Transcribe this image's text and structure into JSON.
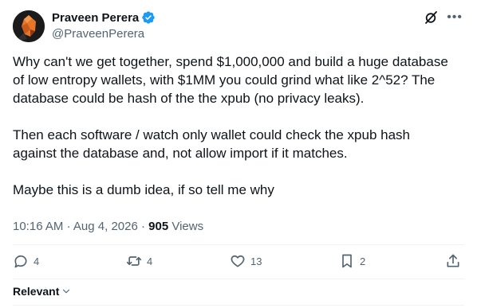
{
  "author": {
    "name": "Praveen Perera",
    "handle": "@PraveenPerera"
  },
  "tweet": {
    "paragraphs": [
      "Why can't we get together, spend $1,000,000 and build a huge database\nof low entropy wallets, with $1MM you could grind what like 2^52? The\ndatabase could be hash of the the xpub (no privacy leaks).",
      "Then each software / watch only wallet could check the xpub hash\nagainst the database and, not allow import if it matches.",
      "Maybe this is a dumb idea, if so tell me why"
    ],
    "time": "10:16 AM",
    "date": "Aug 4, 2026",
    "views_count": "905",
    "views_label": "Views"
  },
  "actions": {
    "replies": "4",
    "reposts": "4",
    "likes": "13",
    "bookmarks": "2"
  },
  "sort": {
    "label": "Relevant"
  },
  "colors": {
    "accent": "#1d9bf0",
    "secondary_text": "#536471",
    "divider": "#eff3f4"
  },
  "icons": [
    "grok-icon",
    "more-icon",
    "reply-icon",
    "repost-icon",
    "like-icon",
    "bookmark-icon",
    "share-icon",
    "chevron-down-icon",
    "verified-badge-icon"
  ]
}
